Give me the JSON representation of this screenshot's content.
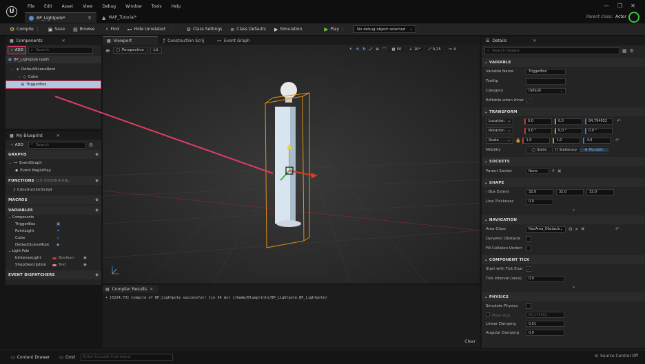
{
  "titlebar": {
    "logo_glyph": "U",
    "menu": [
      "File",
      "Edit",
      "Asset",
      "View",
      "Debug",
      "Window",
      "Tools",
      "Help"
    ],
    "tabs": [
      {
        "label": "BP_Lightpole*",
        "close": "✕"
      },
      {
        "label": "MAP_Tutorial*",
        "icon": "▲"
      }
    ],
    "parent_class_label": "Parent class:",
    "parent_class_value": "Actor",
    "win": {
      "min": "—",
      "max": "❐",
      "close": "✕"
    }
  },
  "toolbar": {
    "compile": "Compile",
    "compile_icon": "⚙",
    "more": "⋮",
    "save": "Save",
    "save_icon": "▣",
    "browse": "Browse",
    "browse_icon": "▤",
    "find": "Find",
    "find_icon": "⌕",
    "hide_unrelated": "Hide Unrelated",
    "hide_icon": "⊷",
    "class_settings": "Class Settings",
    "gear_icon": "⚙",
    "class_defaults": "Class Defaults",
    "defaults_icon": "≡",
    "simulation": "Simulation",
    "sim_icon": "▶",
    "play": "Play",
    "play_icon": "▶",
    "debug_object": "No debug object selected",
    "chevron": "⌄"
  },
  "components": {
    "icon": "▦",
    "title": "Components",
    "close": "✕",
    "plus": "+",
    "add_label": "ADD",
    "search_icon": "⌕",
    "search_placeholder": "Search",
    "self_icon": "●",
    "self_label": "BP_Lightpole (self)",
    "expand": "⌄",
    "root_icon": "◆",
    "cube_icon": "◇",
    "box_icon": "▣",
    "tree": [
      "DefaultSceneRoot",
      "Cube",
      "TriggerBox"
    ]
  },
  "myblueprint": {
    "icon": "▦",
    "title": "My Blueprint",
    "close": "✕",
    "plus": "+",
    "add_label": "ADD",
    "search_icon": "⌕",
    "search_placeholder": "Search",
    "gear": "⚙",
    "addc": "⊕",
    "expand": "⌄",
    "graphs": "GRAPHS",
    "graph_icon": "⊶",
    "event_graph": "EventGraph",
    "event_icon": "◆",
    "begin_play": "Event BeginPlay",
    "functions": "FUNCTIONS",
    "functions_overridable": "(20 OVERRIDABL",
    "func_icon": "ƒ",
    "construction_script": "ConstructionScript",
    "macros": "MACROS",
    "variables": "VARIABLES",
    "components_group": "⌄ Components",
    "component_vars": [
      {
        "name": "TriggerBox",
        "icon": "▣"
      },
      {
        "name": "PointLight",
        "icon": "✦"
      },
      {
        "name": "Cube",
        "icon": "◇"
      },
      {
        "name": "DefaultSceneRoot",
        "icon": "◆"
      }
    ],
    "lightpole_group": "⌄ Light Pole",
    "var_bool": {
      "name": "bIntenseLight",
      "type": "Boolean"
    },
    "var_text": {
      "name": "ShopDescription",
      "type": "Text"
    },
    "eye": "◉",
    "event_dispatchers": "EVENT DISPATCHERS"
  },
  "center": {
    "tabs": [
      "Viewport",
      "Construction Scrij",
      "Event Graph"
    ],
    "tab_icons": [
      "▦",
      "ƒ",
      "⊶"
    ]
  },
  "viewport": {
    "menu_icon": "≡",
    "persp_icon": "▢",
    "perspective": "Perspective",
    "lit": "Lit",
    "tools": [
      "↖",
      "✥",
      "↻",
      "⤢",
      "⊕",
      "⌒"
    ],
    "grid_icon": "▦",
    "grid_snap": "50",
    "angle_icon": "∠",
    "rot_snap": "10°",
    "scale_icon": "⤢",
    "scale_snap": "0,25",
    "cam_icon": "▭",
    "cam_speed": "4"
  },
  "compiler": {
    "icon": "▤",
    "title": "Compiler Results",
    "close": "✕",
    "message": "• [5224.73] Compile of BP_Lightpole successful! [in 34 ms] (/Game/Blueprints/BP_Lightpole.BP_Lightpole)",
    "clear": "Clear"
  },
  "details": {
    "icon": "☰",
    "title": "Details",
    "close": "✕",
    "search_icon": "⌕",
    "search_placeholder": "Search Details",
    "table_icon": "▦",
    "gear": "⚙",
    "check": "✓",
    "chevron": "⌄",
    "expand": "›",
    "x": "✕",
    "reset": "↶",
    "use_sel": "⊙",
    "sections": {
      "variable": "⌄  VARIABLE",
      "transform": "⌄  TRANSFORM",
      "sockets": "⌄  SOCKETS",
      "shape": "⌄  SHAPE",
      "navigation": "⌄  NAVIGATION",
      "component_tick": "⌄  COMPONENT TICK",
      "physics": "⌄  PHYSICS"
    },
    "variable": {
      "name_label": "Variable Name",
      "name_value": "TriggerBox",
      "tooltip_label": "Tooltip",
      "category_label": "Category",
      "category_value": "Default",
      "editable_label": "Editable when Inher"
    },
    "transform": {
      "rows": [
        {
          "label": "Location",
          "values": [
            "0,0",
            "0,0",
            "84,794052"
          ]
        },
        {
          "label": "Rotation",
          "values": [
            "0,0 °",
            "0,0 °",
            "0,0 °"
          ]
        },
        {
          "label": "Scale",
          "values": [
            "1,0",
            "1,0",
            "4,0"
          ]
        }
      ],
      "mobility_label": "Mobility",
      "mobility": [
        "Static",
        "Stationary",
        "Movable"
      ],
      "static_icon": "◯",
      "stationary_icon": "⌈⌉",
      "movable_icon": "✥"
    },
    "sockets": {
      "label": "Parent Socket",
      "value": "None"
    },
    "shape": {
      "box_extent_label": "Box Extent",
      "box_extent": [
        "32,0",
        "32,0",
        "32,0"
      ],
      "line_thickness_label": "Line Thickness",
      "line_thickness": "0,0"
    },
    "navigation": {
      "area_class_label": "Area Class",
      "area_class_value": "NavArea_Obstacle",
      "dynamic_obstacle_label": "Dynamic Obstacle",
      "fill_collision_label": "Fill Collision Underr"
    },
    "tick": {
      "start_label": "Start with Tick Enal",
      "interval_label": "Tick Interval (secs)",
      "interval_value": "0,0"
    },
    "physics": {
      "simulate_label": "Simulate Physics",
      "mass_label": "Mass (kg)",
      "mass_value": "69,149582",
      "linear_label": "Linear Damping",
      "linear_value": "0,01",
      "angular_label": "Angular Damping",
      "angular_value": "0,0"
    }
  },
  "statusbar": {
    "drawer_icon": "▭",
    "content_drawer": "Content Drawer",
    "cmd_icon": "▭",
    "cmd": "Cmd",
    "console_placeholder": "Enter Console Command",
    "sc_icon": "⊘",
    "source_control": "Source Control Off"
  }
}
